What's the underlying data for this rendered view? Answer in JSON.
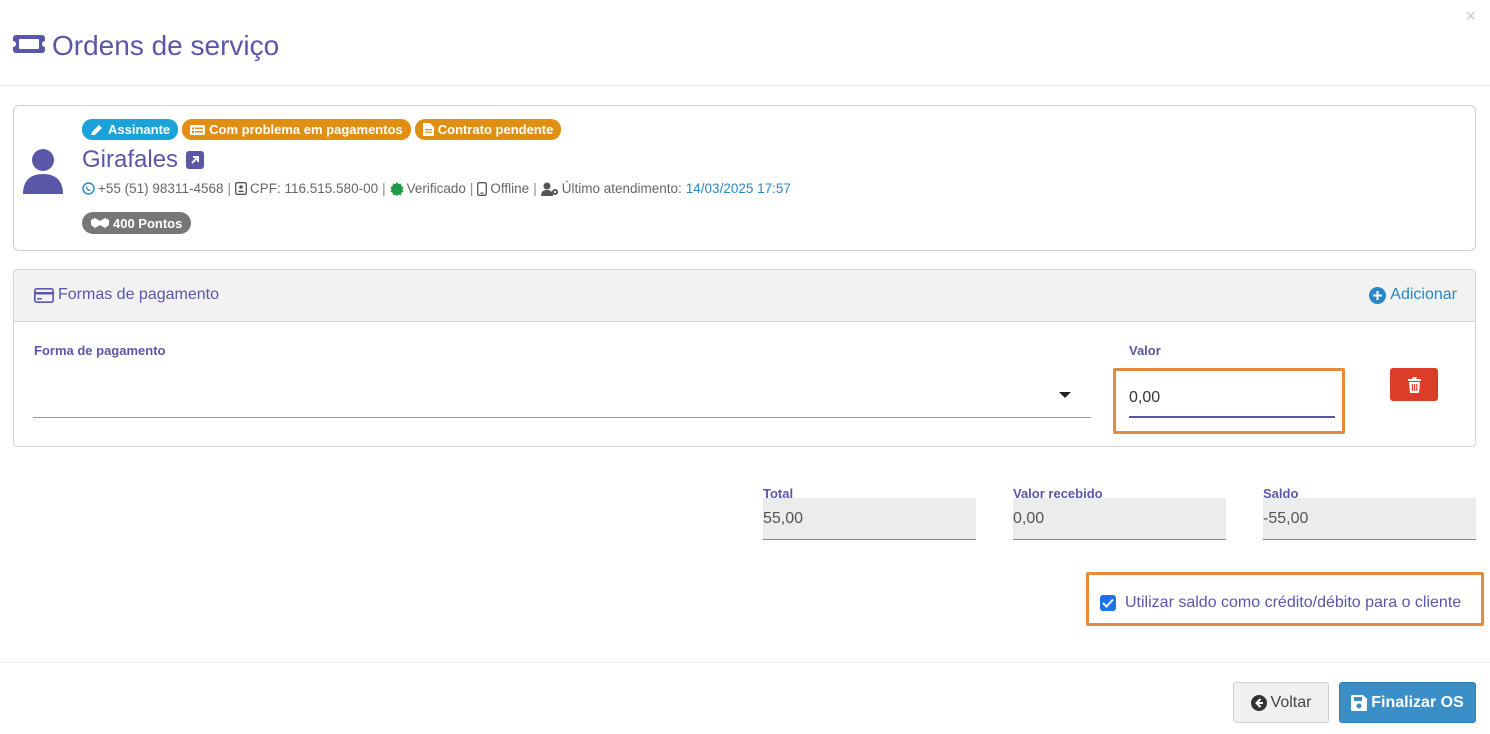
{
  "modal": {
    "title": "Ordens de serviço",
    "close_label": "×"
  },
  "client": {
    "badges": [
      {
        "label": "Assinante",
        "color": "#1aa3db"
      },
      {
        "label": "Com problema em pagamentos",
        "color": "#e18f13"
      },
      {
        "label": "Contrato pendente",
        "color": "#e18f13"
      }
    ],
    "name": "Girafales",
    "phone": "+55 (51) 98311-4568",
    "cpf": "CPF: 116.515.580-00",
    "verified": "Verificado",
    "status": "Offline",
    "last_service_label": "Último atendimento:",
    "last_service_date": "14/03/2025 17:57",
    "points": "400 Pontos"
  },
  "payment": {
    "section_title": "Formas de pagamento",
    "add_label": "Adicionar",
    "method_label": "Forma de pagamento",
    "method_value": "",
    "value_label": "Valor",
    "value": "0,00"
  },
  "summary": {
    "total_label": "Total",
    "total": "55,00",
    "received_label": "Valor recebido",
    "received": "0,00",
    "balance_label": "Saldo",
    "balance": "-55,00"
  },
  "options": {
    "use_balance_label": "Utilizar saldo como crédito/débito para o cliente",
    "use_balance_checked": true
  },
  "footer": {
    "back_label": "Voltar",
    "finish_label": "Finalizar OS"
  },
  "colors": {
    "primary": "#5a56a8",
    "accent_blue": "#3a8fc9",
    "danger": "#dc3c2a",
    "highlight": "#e58a3e"
  }
}
